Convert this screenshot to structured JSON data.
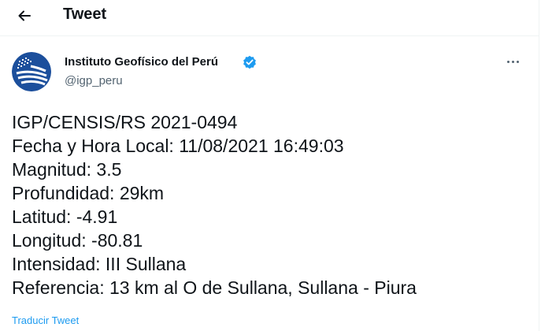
{
  "header": {
    "title": "Tweet"
  },
  "author": {
    "name": "Instituto Geofísico del Perú",
    "handle": "@igp_peru"
  },
  "tweet": {
    "lines": [
      "IGP/CENSIS/RS 2021-0494",
      "Fecha y Hora Local: 11/08/2021 16:49:03",
      "Magnitud: 3.5",
      "Profundidad: 29km",
      "Latitud: -4.91",
      "Longitud: -80.81",
      "Intensidad: III Sullana",
      "Referencia: 13 km al O de Sullana, Sullana - Piura"
    ]
  },
  "translate_label": "Traducir Tweet",
  "colors": {
    "accent": "#1d9bf0",
    "avatar": "#1c4f9c"
  },
  "icons": [
    "back-arrow-icon",
    "verified-badge-icon",
    "more-options-icon"
  ]
}
